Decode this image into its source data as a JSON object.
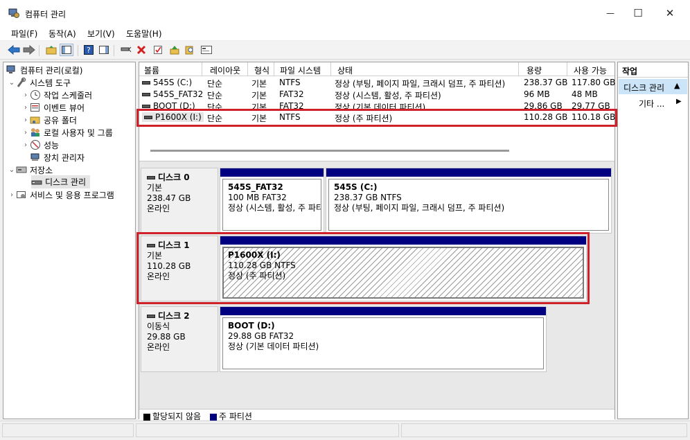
{
  "window": {
    "title": "컴퓨터 관리",
    "minimize": "—",
    "maximize": "☐",
    "close": "✕"
  },
  "menu": [
    "파일(F)",
    "동작(A)",
    "보기(V)",
    "도움말(H)"
  ],
  "tree": {
    "root": "컴퓨터 관리(로컬)",
    "system_tools": "시스템 도구",
    "task_scheduler": "작업 스케줄러",
    "event_viewer": "이벤트 뷰어",
    "shared_folders": "공유 폴더",
    "local_users": "로컬 사용자 및 그룹",
    "performance": "성능",
    "device_manager": "장치 관리자",
    "storage": "저장소",
    "disk_management": "디스크 관리",
    "services": "서비스 및 응용 프로그램"
  },
  "volumes": {
    "columns": [
      "볼륨",
      "레이아웃",
      "형식",
      "파일 시스템",
      "상태",
      "용량",
      "사용 가능"
    ],
    "rows": [
      {
        "volume": "545S (C:)",
        "layout": "단순",
        "type": "기본",
        "fs": "NTFS",
        "status": "정상 (부팅, 페이지 파일, 크래시 덤프, 주 파티션)",
        "capacity": "238.37 GB",
        "free": "117.80 GB"
      },
      {
        "volume": "545S_FAT32",
        "layout": "단순",
        "type": "기본",
        "fs": "FAT32",
        "status": "정상 (시스템, 활성, 주 파티션)",
        "capacity": "96 MB",
        "free": "48 MB"
      },
      {
        "volume": "BOOT (D:)",
        "layout": "단순",
        "type": "기본",
        "fs": "FAT32",
        "status": "정상 (기본 데이터 파티션)",
        "capacity": "29.86 GB",
        "free": "29.77 GB"
      },
      {
        "volume": "P1600X (I:)",
        "layout": "단순",
        "type": "기본",
        "fs": "NTFS",
        "status": "정상 (주 파티션)",
        "capacity": "110.28 GB",
        "free": "110.18 GB"
      }
    ]
  },
  "disks": [
    {
      "name": "디스크 0",
      "kind": "기본",
      "size": "238.47 GB",
      "state": "온라인",
      "partitions": [
        {
          "name": "545S_FAT32",
          "size": "100 MB FAT32",
          "status": "정상 (시스템, 활성, 주 파티"
        },
        {
          "name": "545S  (C:)",
          "size": "238.37 GB NTFS",
          "status": "정상 (부팅, 페이지 파일, 크래시 덤프, 주 파티션)"
        }
      ]
    },
    {
      "name": "디스크 1",
      "kind": "기본",
      "size": "110.28 GB",
      "state": "온라인",
      "partitions": [
        {
          "name": "P1600X  (I:)",
          "size": "110.28 GB NTFS",
          "status": "정상 (주 파티션)"
        }
      ]
    },
    {
      "name": "디스크 2",
      "kind": "이동식",
      "size": "29.88 GB",
      "state": "온라인",
      "partitions": [
        {
          "name": "BOOT  (D:)",
          "size": "29.88 GB FAT32",
          "status": "정상 (기본 데이터 파티션)"
        }
      ]
    }
  ],
  "legend": {
    "unallocated": "할당되지 않음",
    "primary": "주 파티션"
  },
  "actions": {
    "header": "작업",
    "section": "디스크 관리",
    "more": "기타 ..."
  },
  "colors": {
    "primary_partition": "#000080",
    "unallocated": "#000000",
    "highlight": "#d0202a",
    "selected_action": "#cce4f7"
  }
}
